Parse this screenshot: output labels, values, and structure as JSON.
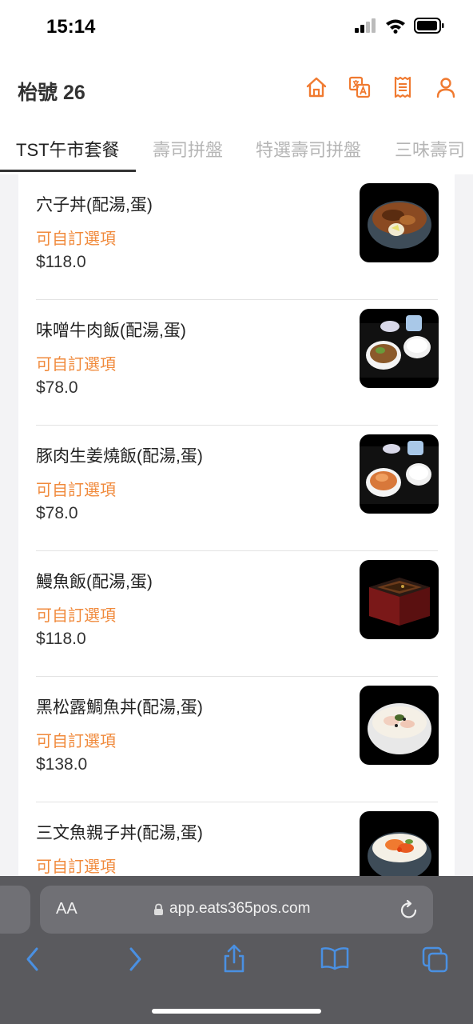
{
  "status": {
    "time": "15:14"
  },
  "header": {
    "title": "枱號 26",
    "accent": "#f07a30"
  },
  "tabs": [
    {
      "label": "TST午市套餐",
      "active": true
    },
    {
      "label": "壽司拼盤",
      "active": false
    },
    {
      "label": "特選壽司拼盤",
      "active": false
    },
    {
      "label": "三味壽司",
      "active": false
    }
  ],
  "items": [
    {
      "name": "穴子丼(配湯,蛋)",
      "custom": "可自訂選項",
      "price": "$118.0"
    },
    {
      "name": "味噌牛肉飯(配湯,蛋)",
      "custom": "可自訂選項",
      "price": "$78.0"
    },
    {
      "name": "豚肉生姜燒飯(配湯,蛋)",
      "custom": "可自訂選項",
      "price": "$78.0"
    },
    {
      "name": "鰻魚飯(配湯,蛋)",
      "custom": "可自訂選項",
      "price": "$118.0"
    },
    {
      "name": "黑松露鯛魚丼(配湯,蛋)",
      "custom": "可自訂選項",
      "price": "$138.0"
    },
    {
      "name": "三文魚親子丼(配湯,蛋)",
      "custom": "可自訂選項",
      "price": ""
    }
  ],
  "browser": {
    "aa": "AA",
    "url": "app.eats365pos.com"
  },
  "colors": {
    "custom_text": "#f08a3c",
    "safari_blue": "#4a90e2"
  }
}
